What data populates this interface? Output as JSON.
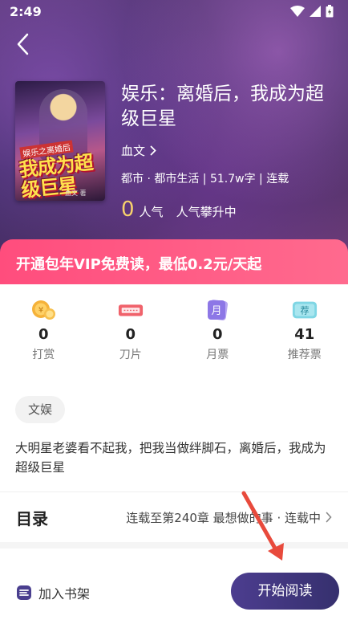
{
  "status_bar": {
    "time": "2:49"
  },
  "book": {
    "title": "娱乐：离婚后，我成为超级巨星",
    "author": "血文",
    "meta": "都市 · 都市生活 | 51.7w字 | 连载",
    "popularity": "0",
    "popularity_label": "人气",
    "popularity_rank": "人气攀升中"
  },
  "cover": {
    "title_top": "娱乐之离婚后",
    "title_main": "我成为超级巨星",
    "author": "血文 著"
  },
  "vip_banner": "开通包年VIP免费读，最低0.2元/天起",
  "stats": [
    {
      "icon": "coin-icon",
      "value": "0",
      "label": "打赏"
    },
    {
      "icon": "blade-icon",
      "value": "0",
      "label": "刀片"
    },
    {
      "icon": "monthly-ticket-icon",
      "value": "0",
      "label": "月票"
    },
    {
      "icon": "recommend-ticket-icon",
      "value": "41",
      "label": "推荐票"
    }
  ],
  "icon_text": {
    "monthly": "月",
    "recommend": "荐"
  },
  "tag": "文娱",
  "summary": "大明星老婆看不起我，把我当做绊脚石，离婚后，我成为超级巨星",
  "toc": {
    "title": "目录",
    "info": "连载至第240章 最想做的事 · 连载中"
  },
  "bottom_bar": {
    "shelf_label": "加入书架",
    "read_label": "开始阅读"
  },
  "colors": {
    "vip_banner": "#ff5a84",
    "read_button": "#3f3680",
    "popularity_number": "#f7d16c"
  }
}
